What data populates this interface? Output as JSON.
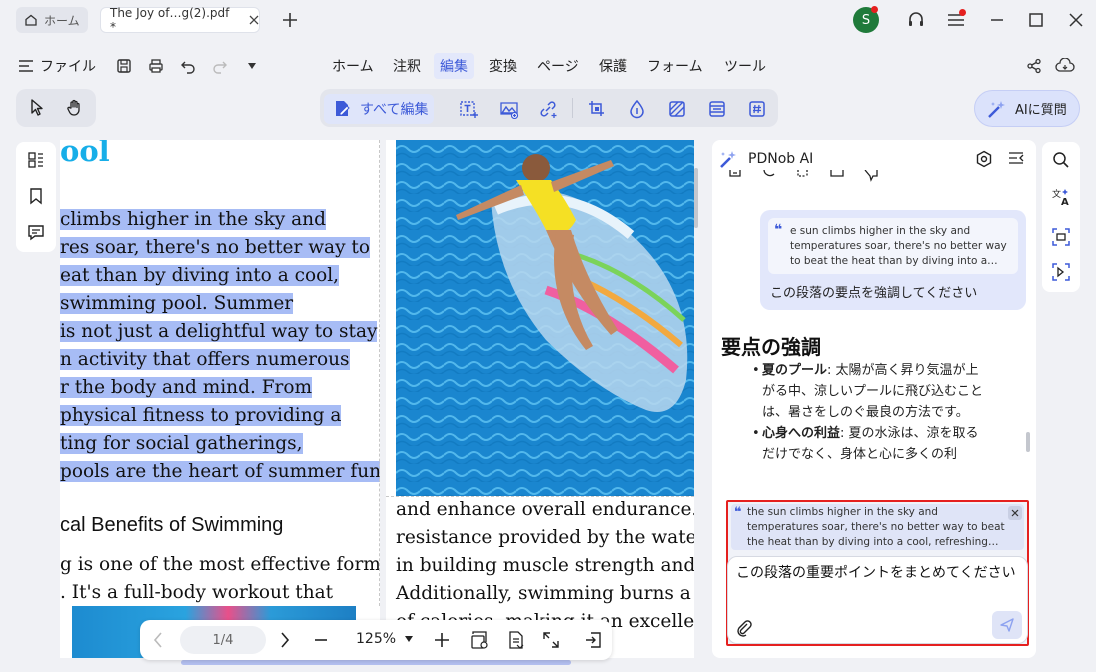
{
  "titlebar": {
    "home_tab": "ホーム",
    "doc_tab": "The Joy of…g(2).pdf *",
    "avatar_letter": "S"
  },
  "menubar": {
    "file_menu": "ファイル",
    "items": [
      "ホーム",
      "注釈",
      "編集",
      "変換",
      "ページ",
      "保護",
      "フォーム",
      "ツール"
    ],
    "active": "編集"
  },
  "toolbar": {
    "edit_all": "すべて編集",
    "ask_ai": "AIに質問"
  },
  "document": {
    "page1_heading": "ool",
    "page1_lines": [
      "climbs higher in the sky and",
      "res soar, there's no better way to",
      "eat than by diving into a cool,",
      "swimming pool. Summer",
      "is not just a delightful way to stay",
      "n activity that offers numerous",
      "r the body and mind. From",
      "physical fitness to providing a",
      "ting for social gatherings,",
      "pools are the heart of summer fun."
    ],
    "page1_subheading": "cal Benefits of Swimming",
    "page1_tail": [
      "g is one of the most effective forms",
      ". It's a full-body workout that"
    ],
    "page2_lines": [
      "and enhance overall endurance. Th",
      "resistance provided by the water al",
      "in building muscle strength and ton",
      "Additionally, swimming burns a hig",
      "of calories, making it an excellent ex"
    ]
  },
  "bottom_nav": {
    "page_indicator": "1/4",
    "zoom": "125%"
  },
  "ai_panel": {
    "title": "PDNob AI",
    "quoted_text": "e sun climbs higher in the sky and temperatures soar, there's no better way to beat the heat than by diving into a cool, refr…",
    "user_message": "この段落の要点を強調してください",
    "answer_heading": "要点の強調",
    "bullet1_bold": "夏のプール",
    "bullet1_text": ": 太陽が高く昇り気温が上がる中、涼しいプールに飛び込むことは、暑さをしのぐ最良の方法です。",
    "bullet2_bold": "心身への利益",
    "bullet2_text": ": 夏の水泳は、涼を取るだけでなく、身体と心に多くの利",
    "input_quote": "the sun climbs higher in the sky and temperatures soar, there's no better way to beat the heat than by diving into a cool, refreshing swimming pool. Summ…",
    "input_text": "この段落の重要ポイントをまとめてください"
  },
  "colors": {
    "accent": "#3d5ad8",
    "highlight": "#a7bcf5",
    "heading_cyan": "#17aee8",
    "input_border": "#e5201f",
    "avatar_green": "#1f7a3a"
  }
}
